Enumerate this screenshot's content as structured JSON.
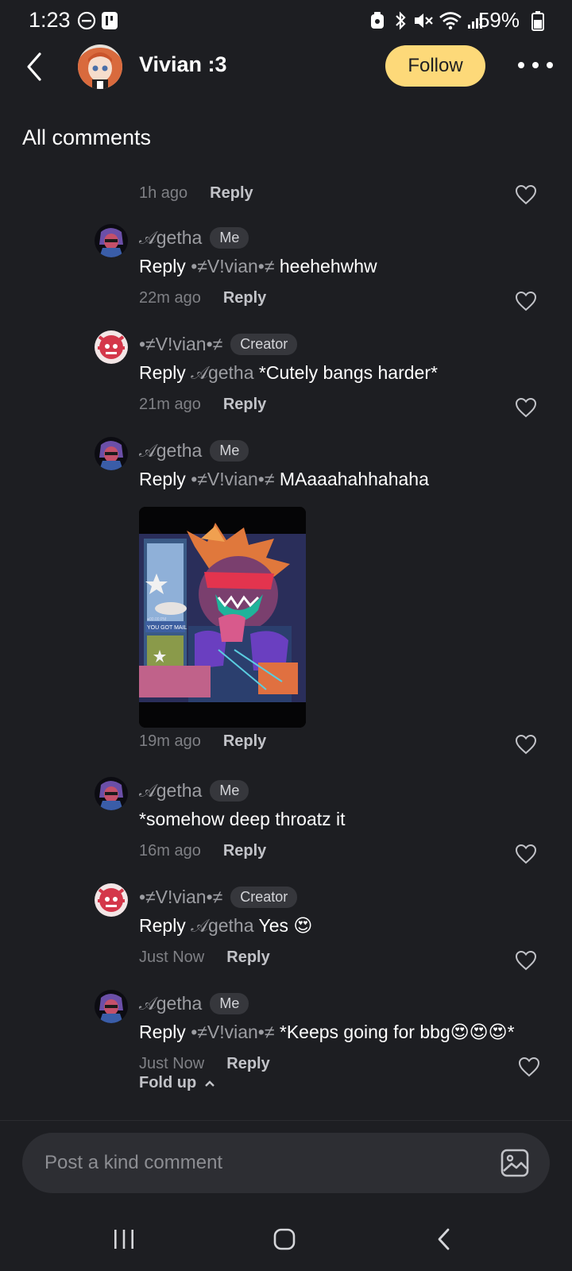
{
  "status_bar": {
    "time": "1:23",
    "battery": "59%"
  },
  "header": {
    "title": "Vivian :3",
    "follow_label": "Follow"
  },
  "section_title": "All comments",
  "comments": [
    {
      "time": "1h ago",
      "reply": "Reply"
    },
    {
      "name": "𝒜getha",
      "badge": "Me",
      "prefix": "Reply ",
      "mention": "•≠V!vian•≠",
      "text": " heehehwhw",
      "time": "22m ago",
      "reply": "Reply"
    },
    {
      "name": "•≠V!vian•≠",
      "badge": "Creator",
      "prefix": "Reply ",
      "mention": "𝒜getha",
      "text": " *Cutely bangs harder*",
      "time": "21m ago",
      "reply": "Reply"
    },
    {
      "name": "𝒜getha",
      "badge": "Me",
      "prefix": "Reply ",
      "mention": "•≠V!vian•≠",
      "text": " MAaaahahhahaha",
      "time": "19m ago",
      "reply": "Reply"
    },
    {
      "name": "𝒜getha",
      "badge": "Me",
      "text": "*somehow deep throatz it",
      "time": "16m ago",
      "reply": "Reply"
    },
    {
      "name": "•≠V!vian•≠",
      "badge": "Creator",
      "prefix": "Reply ",
      "mention": "𝒜getha",
      "text": " Yes 😍",
      "time": "Just Now",
      "reply": "Reply"
    },
    {
      "name": "𝒜getha",
      "badge": "Me",
      "prefix": "Reply ",
      "mention": "•≠V!vian•≠",
      "text": " *Keeps going for bbg😍😍😍*",
      "time": "Just Now",
      "reply": "Reply"
    }
  ],
  "attached_image_text": {
    "line1": "YOU GOT MAIL",
    "line2": "●00.00 PM"
  },
  "fold_up_label": "Fold up",
  "comment_input": {
    "placeholder": "Post a kind comment"
  },
  "colors": {
    "background": "#1d1e22",
    "follow": "#fdd979",
    "muted": "#9c9da2",
    "badge": "#36373c"
  }
}
